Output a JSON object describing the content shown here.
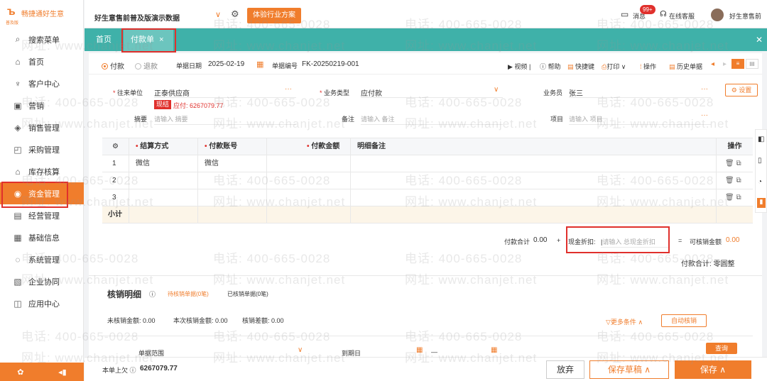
{
  "app": {
    "logo_text": "畅捷通好生意",
    "logo_sub": "普及版",
    "company": "好生意售前普及版演示数据",
    "trial_button": "体验行业方案",
    "messages_label": "消息",
    "messages_badge": "99+",
    "service_label": "在线客服",
    "user_name": "好生意售前"
  },
  "sidebar": {
    "items": [
      {
        "label": "搜索菜单",
        "icon": "search-icon"
      },
      {
        "label": "首页",
        "icon": "home-icon"
      },
      {
        "label": "客户中心",
        "icon": "trophy-icon"
      },
      {
        "label": "营销",
        "icon": "gift-icon"
      },
      {
        "label": "销售管理",
        "icon": "sales-icon"
      },
      {
        "label": "采购管理",
        "icon": "bag-icon"
      },
      {
        "label": "库存核算",
        "icon": "warehouse-icon"
      },
      {
        "label": "资金管理",
        "icon": "money-icon"
      },
      {
        "label": "经营管理",
        "icon": "clipboard-icon"
      },
      {
        "label": "基础信息",
        "icon": "card-icon"
      },
      {
        "label": "系统管理",
        "icon": "spinner-icon"
      },
      {
        "label": "企业协同",
        "icon": "doc-icon"
      },
      {
        "label": "应用中心",
        "icon": "app-icon"
      }
    ]
  },
  "tabs": {
    "home": "首页",
    "active": "付款单",
    "close": "×"
  },
  "form": {
    "type_pay": "付款",
    "type_refund": "退款",
    "date_label": "单据日期",
    "date_value": "2025-02-19",
    "number_label": "单据编号",
    "number_value": "FK-20250219-001",
    "toolbar": [
      "视频",
      "帮助",
      "快捷键",
      "打印",
      "操作",
      "历史单据"
    ],
    "vendor_label": "往来单位",
    "vendor_value": "正泰供应商",
    "cash_tag": "现结",
    "payable_text": "应付: 6267079.77",
    "biz_type_label": "业务类型",
    "biz_type_value": "应付款",
    "clerk_label": "业务员",
    "clerk_value": "张三",
    "settings_button": "设置",
    "summary_label": "摘要",
    "summary_placeholder": "请输入 摘要",
    "remark_label": "备注",
    "remark_placeholder": "请输入 备注",
    "project_label": "项目",
    "project_placeholder": "请输入 项目"
  },
  "grid": {
    "headers": [
      "结算方式",
      "付款账号",
      "付款金额",
      "明细备注",
      "操作"
    ],
    "rows": [
      {
        "no": "1",
        "method": "微信",
        "account": "微信",
        "amount": "",
        "note": ""
      },
      {
        "no": "2",
        "method": "",
        "account": "",
        "amount": "",
        "note": ""
      },
      {
        "no": "3",
        "method": "",
        "account": "",
        "amount": "",
        "note": ""
      }
    ],
    "subtotal_label": "小计"
  },
  "totals": {
    "pay_total_label": "付款合计",
    "pay_total_value": "0.00",
    "plus": "+",
    "cash_discount_label": "现金折扣:",
    "cash_discount_placeholder": "请输入 总现金折扣",
    "equals": "=",
    "writeoff_label": "可核销金额",
    "writeoff_value": "0.00",
    "round_text": "付款合计: 零圆整"
  },
  "writeoff": {
    "title": "核销明细",
    "tab_pending": "待核销单据(0笔)",
    "tab_done": "已核销单据(0笔)",
    "unwritten_label": "未核销金额: 0.00",
    "current_label": "本次核销金额: 0.00",
    "diff_label": "核销差额: 0.00",
    "more_conditions": "更多条件",
    "auto_button": "自动核销",
    "range_label": "单据范围",
    "due_label": "到期日",
    "dash": "—",
    "query_button": "查询"
  },
  "footer": {
    "prev_balance_label": "本单上欠",
    "prev_balance_value": "6267079.77",
    "discard": "放弃",
    "save_draft": "保存草稿",
    "save": "保存"
  },
  "watermark": {
    "phone": "电话: 400-665-0028",
    "site": "网址: www.chanjet.net"
  },
  "colors": {
    "brand": "#f07d2c",
    "tabbar": "#3fb1a9",
    "highlight": "#e0302c"
  }
}
